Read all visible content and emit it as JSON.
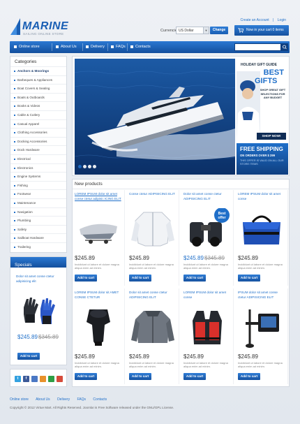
{
  "header": {
    "logo_text": "MARINE",
    "tagline": "SAILING ONLINE STORE",
    "create_account": "Create an Account",
    "sep": "|",
    "login": "Login",
    "currencies_label": "Currencies",
    "currency_value": "US Dollar",
    "change_label": "Change",
    "cart_text": "Now in your cart 0 items"
  },
  "nav": {
    "items": [
      "Online store",
      "About Us",
      "Delivery",
      "FAQs",
      "Contacts"
    ],
    "search_placeholder": ""
  },
  "categories": {
    "title": "Categories",
    "items": [
      "Anchors & Moorings",
      "Barbeques & Appliances",
      "Boat Covers & Seating",
      "Boats & Outboards",
      "Books & Videos",
      "Cable & Cutlery",
      "Casual Apparel",
      "Clothing Accessories",
      "Docking Accessories",
      "Dock Hardware",
      "Electrical",
      "Electronics",
      "Engine Systems",
      "Fishing",
      "Footwear",
      "Maintenance",
      "Navigation",
      "Plumbing",
      "Safety",
      "Sailboat Hardware",
      "Trailering"
    ]
  },
  "specials": {
    "title": "Specials",
    "name": "Dolor sit amet conse ctetur adipisicing elit",
    "price": "$245.89",
    "old_price": "$345.89",
    "cart_label": "Add to cart"
  },
  "slider": {
    "promo_tag": "HOLIDAY GIFT GUIDE",
    "best": "BEST",
    "gifts": "GIFTS",
    "promo_desc": "SHOP GREAT GIFT SELECTIONS FOR ANY BUDGET",
    "shop_now": "SHOP NOW!",
    "free_shipping": "FREE SHIPPING",
    "free_sub": "ON ORDERS OVER $ 299",
    "free_note": "THIS OFFER IS VALID ON ALL OUR STORE ITEMS"
  },
  "products": {
    "title": "New products",
    "desc": "Incididunt ut labore et dolore magna aliqua enim ad minim.",
    "cart_label": "Add to cart",
    "items": [
      {
        "name": "LOREM IPSUM dolor sit amet conse ctetur adipisic ICING ELIT",
        "price": "$245.89",
        "old_price": ""
      },
      {
        "name": "Conse ctetur ADIPISICING ELIT",
        "price": "$245.89",
        "old_price": ""
      },
      {
        "name": "Dolor sit amet conse ctetur ADIPISICING ELIT",
        "price": "$245.89",
        "old_price": "$345.89"
      },
      {
        "name": "LOREM IPSUM dolor sit amet conse",
        "price": "$245.89",
        "old_price": ""
      },
      {
        "name": "LOREM IPSUM dolor sit AMET CONSE CTETUR",
        "price": "$245.89",
        "old_price": ""
      },
      {
        "name": "Dolor sit amet conse ctetur ADIPISICING ELIT",
        "price": "$245.89",
        "old_price": ""
      },
      {
        "name": "LOREM IPSUM dolor sit amet conse",
        "price": "$245.89",
        "old_price": ""
      },
      {
        "name": "IPSUM dolor sit amet conse ctetur ADIPISICING ELIT",
        "price": "$245.89",
        "old_price": ""
      }
    ],
    "best_offer": "Best offer"
  },
  "footer": {
    "links": [
      "Online store",
      "About Us",
      "Delivery",
      "FAQs",
      "Contacts"
    ],
    "copyright": "Copyright © 2012 Virtue Mart. All Rights Reserved. Joomla! is Free Software released under the GNU/GPL License."
  },
  "colors": {
    "accent": "#1f6fc9",
    "nav_dark": "#134f9d"
  }
}
